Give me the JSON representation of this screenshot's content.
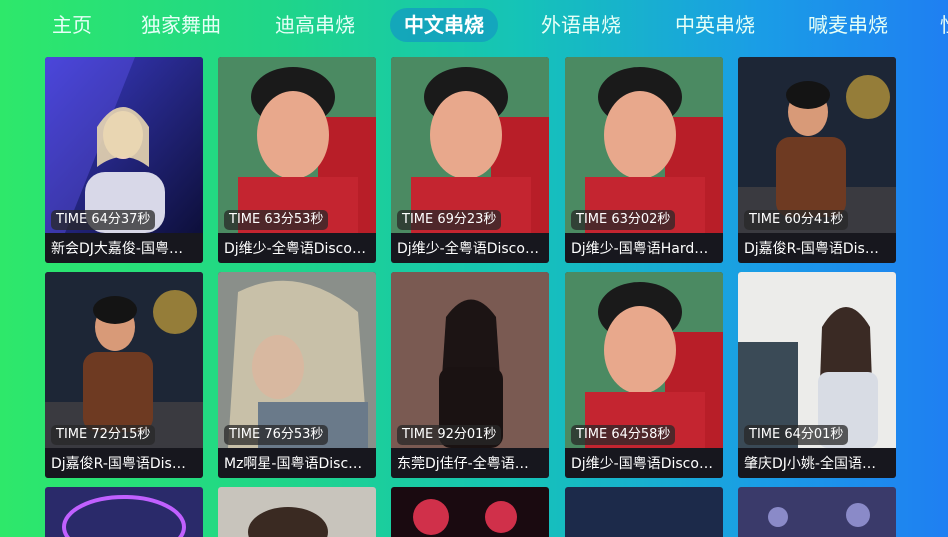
{
  "tabs": [
    {
      "label": "主页",
      "active": false
    },
    {
      "label": "独家舞曲",
      "active": false
    },
    {
      "label": "迪高串烧",
      "active": false
    },
    {
      "label": "中文串烧",
      "active": true
    },
    {
      "label": "外语串烧",
      "active": false
    },
    {
      "label": "中英串烧",
      "active": false
    },
    {
      "label": "喊麦串烧",
      "active": false
    },
    {
      "label": "性",
      "active": false
    }
  ],
  "cards": [
    {
      "time": "TIME 64分37秒",
      "title": "新会DJ大嘉俊-国粤…"
    },
    {
      "time": "TIME 63分53秒",
      "title": "Dj维少-全粤语Disco…"
    },
    {
      "time": "TIME 69分23秒",
      "title": "Dj维少-全粤语Disco…"
    },
    {
      "time": "TIME 63分02秒",
      "title": "Dj维少-国粤语Hard…"
    },
    {
      "time": "TIME 60分41秒",
      "title": "Dj嘉俊R-国粤语Dis…"
    },
    {
      "time": "TIME 72分15秒",
      "title": "Dj嘉俊R-国粤语Dis…"
    },
    {
      "time": "TIME 76分53秒",
      "title": "Mz啊星-国粤语Disc…"
    },
    {
      "time": "TIME 92分01秒",
      "title": "东莞Dj佳仔-全粤语…"
    },
    {
      "time": "TIME 64分58秒",
      "title": "Dj维少-国粤语Disco…"
    },
    {
      "time": "TIME 64分01秒",
      "title": "肇庆DJ小姚-全国语…"
    }
  ]
}
